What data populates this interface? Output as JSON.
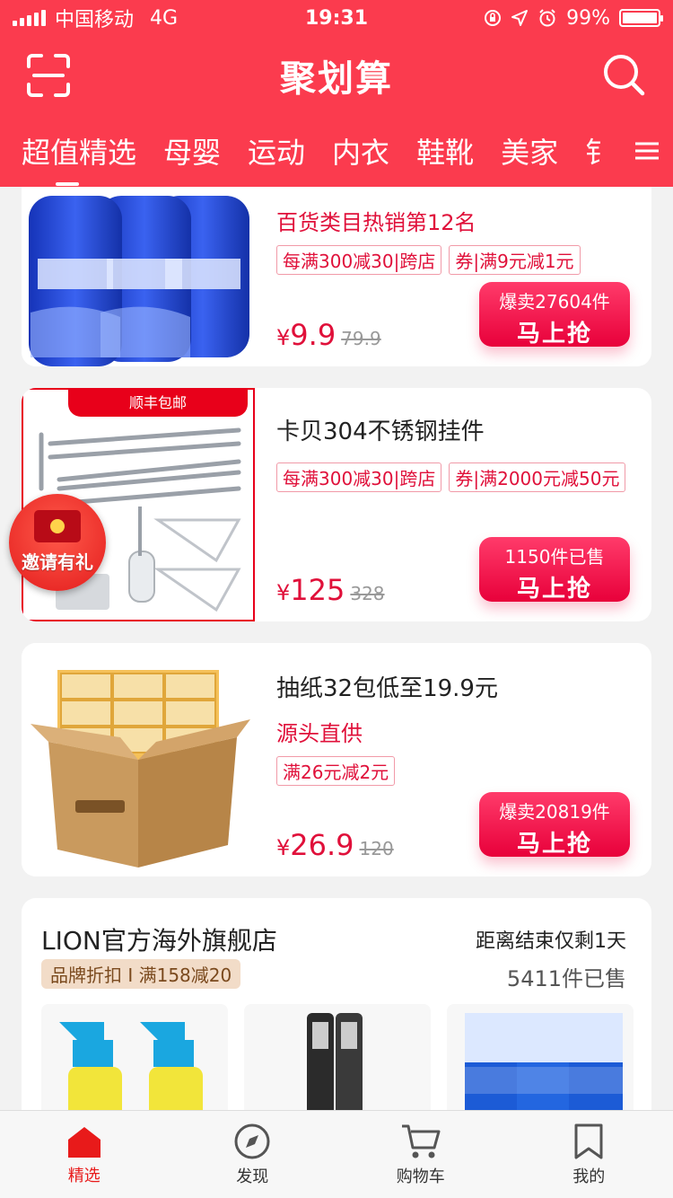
{
  "status": {
    "carrier": "中国移动",
    "network": "4G",
    "time": "19:31",
    "battery": "99%",
    "battery_level": 0.99
  },
  "header": {
    "title": "聚划算"
  },
  "tabs": [
    {
      "label": "超值精选"
    },
    {
      "label": "母婴"
    },
    {
      "label": "运动"
    },
    {
      "label": "内衣"
    },
    {
      "label": "鞋靴"
    },
    {
      "label": "美家"
    },
    {
      "label": "钅"
    }
  ],
  "products": [
    {
      "title": "百货类目热销第12名",
      "tags": [
        "每满300减30|跨店",
        "券|满9元减1元"
      ],
      "price_symbol": "¥",
      "price": "9.9",
      "orig": "79.9",
      "sold": "爆卖27604件",
      "buy": "马上抢"
    },
    {
      "ribbon": "顺丰包邮",
      "title": "卡贝304不锈钢挂件",
      "tags": [
        "每满300减30|跨店",
        "券|满2000元减50元"
      ],
      "price_symbol": "¥",
      "price": "125",
      "orig": "328",
      "sold": "1150件已售",
      "buy": "马上抢"
    },
    {
      "title": "抽纸32包低至19.9元",
      "subtitle": "源头直供",
      "tags": [
        "满26元减2元"
      ],
      "price_symbol": "¥",
      "price": "26.9",
      "orig": "120",
      "sold": "爆卖20819件",
      "buy": "马上抢"
    }
  ],
  "invite": {
    "label": "邀请有礼"
  },
  "shop": {
    "name": "LION官方海外旗舰店",
    "tag": "品牌折扣 I 满158减20",
    "remain": "距离结束仅剩1天",
    "sold": "5411件已售"
  },
  "tabbar": [
    {
      "label": "精选"
    },
    {
      "label": "发现"
    },
    {
      "label": "购物车"
    },
    {
      "label": "我的"
    }
  ],
  "colors": {
    "brand": "#fb3b4e",
    "accent": "#e0103a",
    "tab_active": "#e81a1a"
  }
}
